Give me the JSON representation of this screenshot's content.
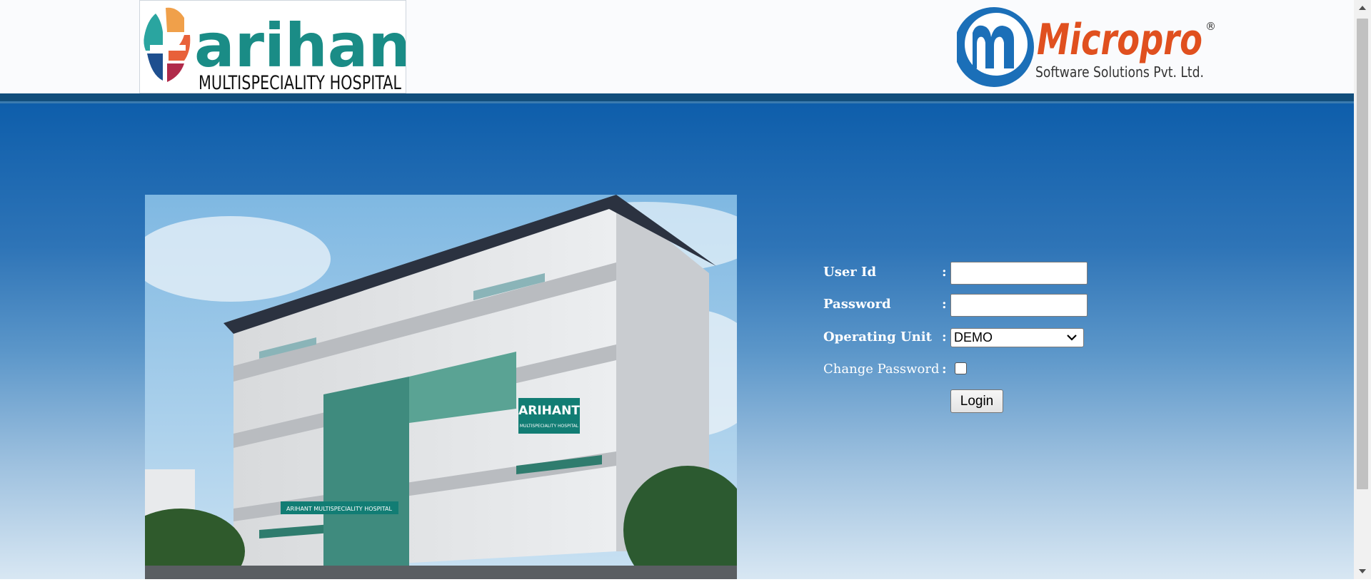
{
  "header": {
    "hospital_logo": {
      "word": "arihant",
      "subtitle": "MULTISPECIALITY HOSPITAL"
    },
    "vendor_logo": {
      "name": "Micropro",
      "registered": "®",
      "tagline": "Software Solutions Pvt. Ltd."
    }
  },
  "hero": {
    "building_sign": "ARIHANT",
    "building_sign_sub": "MULTISPECIALITY HOSPITAL",
    "canopy_sign": "ARIHANT MULTISPECIALITY HOSPITAL"
  },
  "form": {
    "user_id_label": "User Id",
    "password_label": "Password",
    "operating_unit_label": "Operating Unit",
    "change_password_label": "Change Password",
    "colon": ":",
    "user_id_value": "",
    "password_value": "",
    "operating_unit_value": "DEMO",
    "change_password_checked": false,
    "login_label": "Login"
  },
  "colors": {
    "header_bg": "#fafbfd",
    "header_rule": "#124e7c",
    "main_top": "#0e5eab",
    "main_bottom": "#d8e7f3",
    "logo_teal": "#1a8c86",
    "logo_orange": "#e0501f",
    "logo_blue": "#1b6fb8"
  },
  "icons": {
    "select_chevron": "chevron-down-icon",
    "scroll_up": "arrow-up-icon",
    "scroll_down": "arrow-down-icon"
  }
}
